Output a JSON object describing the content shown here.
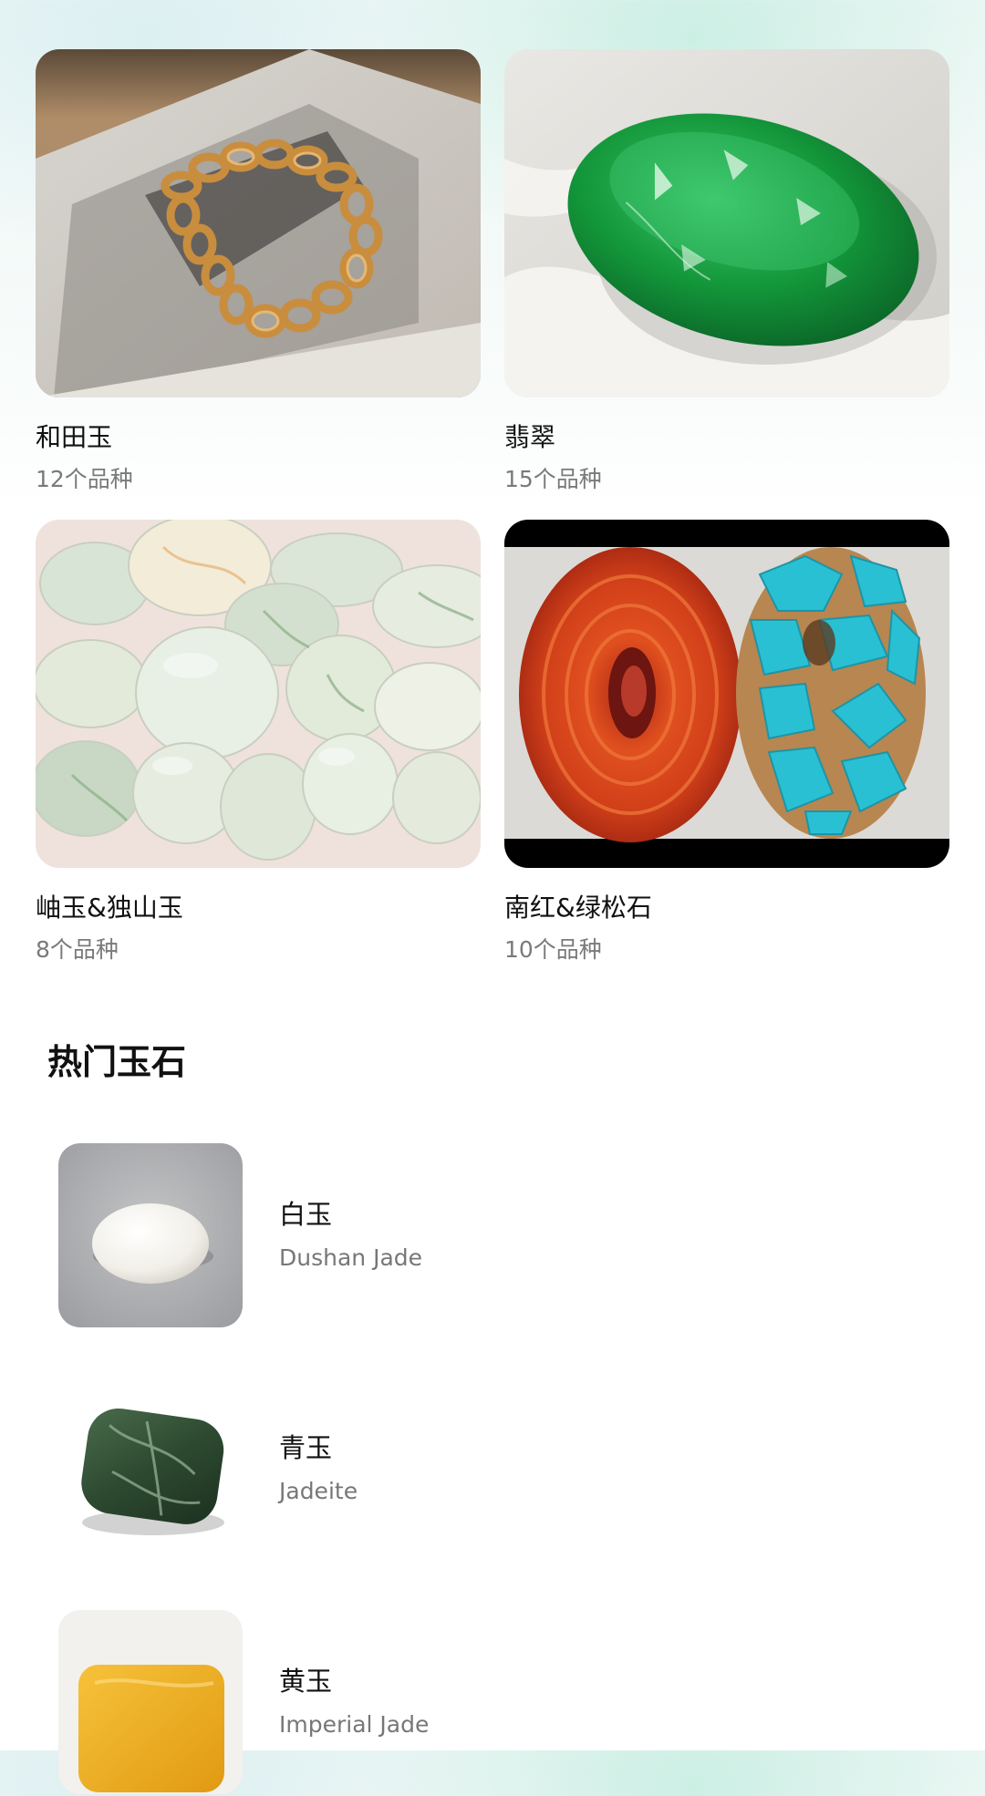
{
  "categories": [
    {
      "name": "和田玉",
      "count": "12个品种",
      "image": "gold-chain-bracelet-photo"
    },
    {
      "name": "翡翠",
      "count": "15个品种",
      "image": "green-jade-stone-photo"
    },
    {
      "name": "岫玉&独山玉",
      "count": "8个品种",
      "image": "pale-jade-pebbles-photo"
    },
    {
      "name": "南红&绿松石",
      "count": "10个品种",
      "image": "red-agate-turquoise-photo"
    }
  ],
  "hot_section": {
    "title": "热门玉石",
    "items": [
      {
        "name": "白玉",
        "english": "Dushan Jade",
        "image": "white-jade-photo"
      },
      {
        "name": "青玉",
        "english": "Jadeite",
        "image": "dark-green-jade-photo"
      },
      {
        "name": "黄玉",
        "english": "Imperial Jade",
        "image": "yellow-jade-photo"
      }
    ]
  }
}
